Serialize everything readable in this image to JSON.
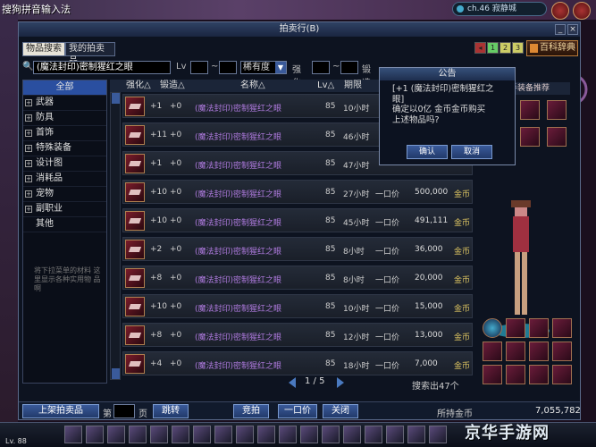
{
  "top": {
    "caption": "搜狗拼音输入法",
    "channel": "ch.46 寂静城"
  },
  "window": {
    "title": "拍卖行(B)"
  },
  "tabs": [
    "物品搜索",
    "我的拍卖品"
  ],
  "pages": [
    "1",
    "2",
    "3"
  ],
  "book_button": "百科辞典",
  "search": {
    "keyword": "(魔法封印)密制猩红之眼",
    "level_label": "Lv",
    "rarity_label": "稀有度",
    "enhance_label": "强化",
    "forge_label": "锻造",
    "tilde": "~"
  },
  "categories": [
    {
      "label": "全部",
      "selected": true,
      "expandable": false
    },
    {
      "label": "武器",
      "selected": false,
      "expandable": true
    },
    {
      "label": "防具",
      "selected": false,
      "expandable": true
    },
    {
      "label": "首饰",
      "selected": false,
      "expandable": true
    },
    {
      "label": "特殊装备",
      "selected": false,
      "expandable": true
    },
    {
      "label": "设计图",
      "selected": false,
      "expandable": true
    },
    {
      "label": "消耗品",
      "selected": false,
      "expandable": true
    },
    {
      "label": "宠物",
      "selected": false,
      "expandable": true
    },
    {
      "label": "副职业",
      "selected": false,
      "expandable": true
    },
    {
      "label": "其他",
      "selected": false,
      "expandable": false
    }
  ],
  "side_note": "将下拉菜单的材料 这里显示各种实用物 品啊",
  "columns": {
    "enhance": "强化△",
    "forge": "锻造△",
    "name": "名称△",
    "level": "Lv△",
    "period": "期限"
  },
  "rows": [
    {
      "enhance": "+1",
      "forge": "+0",
      "name": "(魔法封印)密制猩红之眼",
      "level": "85",
      "time": "10小时",
      "bid": "",
      "price": "",
      "gold": ""
    },
    {
      "enhance": "+11",
      "forge": "+0",
      "name": "(魔法封印)密制猩红之眼",
      "level": "85",
      "time": "46小时",
      "bid": "",
      "price": "",
      "gold": ""
    },
    {
      "enhance": "+1",
      "forge": "+0",
      "name": "(魔法封印)密制猩红之眼",
      "level": "85",
      "time": "47小时",
      "bid": "",
      "price": "",
      "gold": ""
    },
    {
      "enhance": "+10",
      "forge": "+0",
      "name": "(魔法封印)密制猩红之眼",
      "level": "85",
      "time": "27小时",
      "bid": "一口价",
      "price": "500,000",
      "gold": "金币"
    },
    {
      "enhance": "+10",
      "forge": "+0",
      "name": "(魔法封印)密制猩红之眼",
      "level": "85",
      "time": "45小时",
      "bid": "一口价",
      "price": "491,111",
      "gold": "金币"
    },
    {
      "enhance": "+2",
      "forge": "+0",
      "name": "(魔法封印)密制猩红之眼",
      "level": "85",
      "time": "8小时",
      "bid": "一口价",
      "price": "36,000",
      "gold": "金币"
    },
    {
      "enhance": "+8",
      "forge": "+0",
      "name": "(魔法封印)密制猩红之眼",
      "level": "85",
      "time": "8小时",
      "bid": "一口价",
      "price": "20,000",
      "gold": "金币"
    },
    {
      "enhance": "+10",
      "forge": "+0",
      "name": "(魔法封印)密制猩红之眼",
      "level": "85",
      "time": "10小时",
      "bid": "一口价",
      "price": "15,000",
      "gold": "金币"
    },
    {
      "enhance": "+8",
      "forge": "+0",
      "name": "(魔法封印)密制猩红之眼",
      "level": "85",
      "time": "12小时",
      "bid": "一口价",
      "price": "13,000",
      "gold": "金币"
    },
    {
      "enhance": "+4",
      "forge": "+0",
      "name": "(魔法封印)密制猩红之眼",
      "level": "85",
      "time": "18小时",
      "bid": "一口价",
      "price": "7,000",
      "gold": "金币"
    }
  ],
  "pager": {
    "text": "1 / 5"
  },
  "result_count": "搜索出47个",
  "bottom": {
    "list_button": "上架拍卖品",
    "page_label": "第",
    "page_suffix": "页",
    "jump_button": "跳转",
    "auction_button": "竞拍",
    "buyout_button": "一口价",
    "close_button": "关闭",
    "gold_label": "所持金币",
    "gold_value": "7,055,782"
  },
  "right": {
    "reco_title": "新手装备推荐",
    "buy_tag": "密制猩红之眼"
  },
  "dialog": {
    "title": "公告",
    "line1": "[+1 (魔法封印)密制猩红之",
    "line2": "眼]",
    "line3": "确定以0亿 金币金币购买",
    "line4": "上述物品吗?",
    "ok": "确认",
    "cancel": "取消"
  },
  "player": {
    "level": "Lv. 88"
  },
  "watermark": "京华手游网"
}
